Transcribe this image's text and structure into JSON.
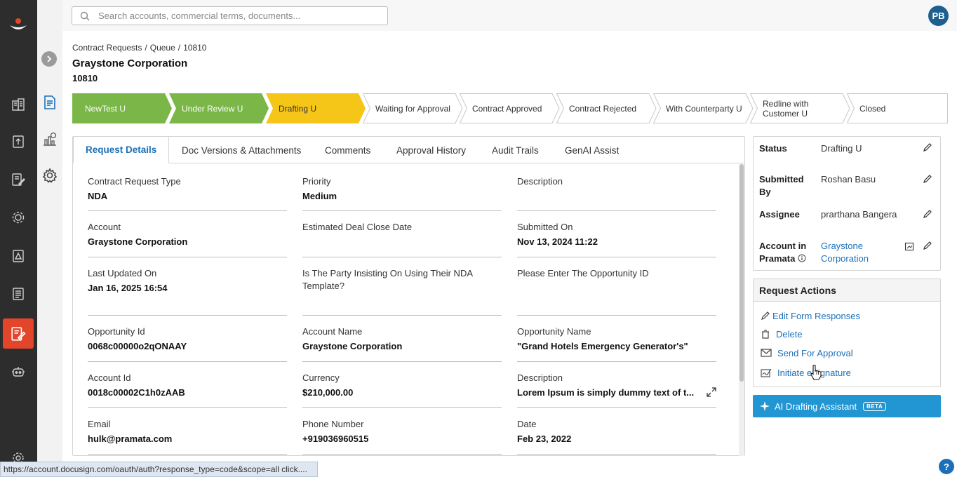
{
  "search": {
    "placeholder": "Search accounts, commercial terms, documents..."
  },
  "user": {
    "initials": "PB"
  },
  "breadcrumb": [
    "Contract Requests",
    "Queue",
    "10810"
  ],
  "header": {
    "title": "Graystone Corporation",
    "id": "10810"
  },
  "stages": [
    {
      "label": "NewTest U",
      "state": "done"
    },
    {
      "label": "Under Review U",
      "state": "done"
    },
    {
      "label": "Drafting U",
      "state": "current"
    },
    {
      "label": "Waiting for Approval",
      "state": "pending"
    },
    {
      "label": "Contract Approved",
      "state": "pending"
    },
    {
      "label": "Contract Rejected",
      "state": "pending"
    },
    {
      "label": "With Counterparty U",
      "state": "pending"
    },
    {
      "label": "Redline with Customer U",
      "state": "pending"
    },
    {
      "label": "Closed",
      "state": "pending"
    }
  ],
  "colors": {
    "done": "#7ab648",
    "current": "#f5c518",
    "accent": "#1d70b8",
    "danger": "#e2452a"
  },
  "tabs": [
    "Request Details",
    "Doc Versions & Attachments",
    "Comments",
    "Approval History",
    "Audit Trails",
    "GenAI Assist"
  ],
  "fields": [
    {
      "label": "Contract Request Type",
      "value": "NDA"
    },
    {
      "label": "Priority",
      "value": "Medium"
    },
    {
      "label": "Description",
      "value": ""
    },
    {
      "label": "Account",
      "value": "Graystone Corporation"
    },
    {
      "label": "Estimated Deal Close Date",
      "value": ""
    },
    {
      "label": "Submitted On",
      "value": "Nov 13, 2024 11:22"
    },
    {
      "label": "Last Updated On",
      "value": "Jan 16, 2025 16:54"
    },
    {
      "label": "Is The Party Insisting On Using Their NDA Template?",
      "value": ""
    },
    {
      "label": "Please Enter The Opportunity ID",
      "value": ""
    },
    {
      "label": "Opportunity Id",
      "value": "0068c00000o2qONAAY"
    },
    {
      "label": "Account Name",
      "value": "Graystone Corporation"
    },
    {
      "label": "Opportunity Name",
      "value": "\"Grand Hotels Emergency Generator's\""
    },
    {
      "label": "Account Id",
      "value": "0018c00002C1h0zAAB"
    },
    {
      "label": "Currency",
      "value": "$210,000.00"
    },
    {
      "label": "Description",
      "value": "Lorem Ipsum is simply dummy text of t..."
    },
    {
      "label": "Email",
      "value": "hulk@pramata.com"
    },
    {
      "label": "Phone Number",
      "value": "+919036960515"
    },
    {
      "label": "Date",
      "value": "Feb 23, 2022"
    }
  ],
  "status_card": {
    "status_label": "Status",
    "status_value": "Drafting U",
    "submitted_label": "Submitted By",
    "submitted_value": "Roshan Basu",
    "assignee_label": "Assignee",
    "assignee_value": "prarthana Bangera",
    "account_label": "Account in Pramata",
    "account_value": "Graystone Corporation"
  },
  "request_actions": {
    "title": "Request Actions",
    "items": [
      "Edit Form Responses",
      "Delete",
      "Send For Approval",
      "Initiate eSignature"
    ]
  },
  "ai_button": {
    "label": "AI Drafting Assistant",
    "badge": "BETA"
  },
  "status_bar": "https://account.docusign.com/oauth/auth?response_type=code&scope=all click....",
  "help": "?"
}
